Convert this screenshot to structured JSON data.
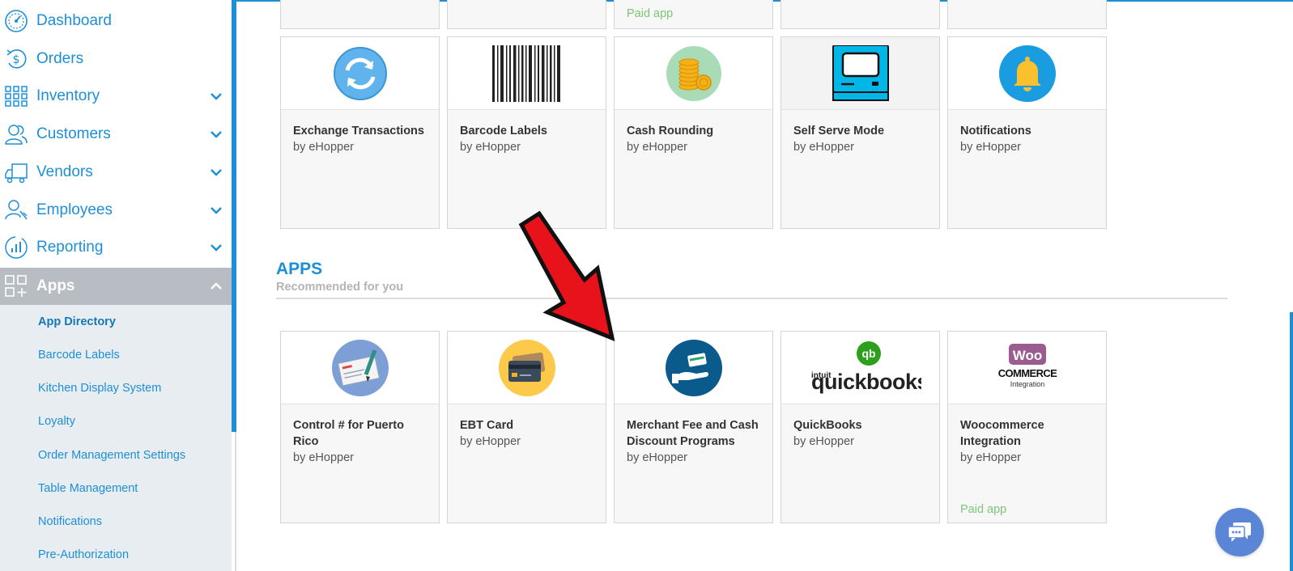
{
  "sidebar": {
    "items": [
      {
        "label": "Dashboard",
        "icon": "gauge-icon",
        "has_chevron": false
      },
      {
        "label": "Orders",
        "icon": "dollar-refresh-icon",
        "has_chevron": false
      },
      {
        "label": "Inventory",
        "icon": "grid-icon",
        "has_chevron": true
      },
      {
        "label": "Customers",
        "icon": "users-icon",
        "has_chevron": true
      },
      {
        "label": "Vendors",
        "icon": "truck-icon",
        "has_chevron": true
      },
      {
        "label": "Employees",
        "icon": "employee-icon",
        "has_chevron": true
      },
      {
        "label": "Reporting",
        "icon": "chart-circle-icon",
        "has_chevron": true
      },
      {
        "label": "Apps",
        "icon": "apps-icon",
        "has_chevron": true,
        "active": true
      }
    ],
    "subitems": [
      {
        "label": "App Directory",
        "current": true
      },
      {
        "label": "Barcode Labels"
      },
      {
        "label": "Kitchen Display System"
      },
      {
        "label": "Loyalty"
      },
      {
        "label": "Order Management Settings"
      },
      {
        "label": "Table Management"
      },
      {
        "label": "Notifications"
      },
      {
        "label": "Pre-Authorization"
      }
    ]
  },
  "top_partial": {
    "paid_label": "Paid app"
  },
  "top_row": [
    {
      "name": "Exchange Transactions",
      "by": "by eHopper",
      "icon": "exchange-refresh-icon"
    },
    {
      "name": "Barcode Labels",
      "by": "by eHopper",
      "icon": "barcode-icon"
    },
    {
      "name": "Cash Rounding",
      "by": "by eHopper",
      "icon": "coins-icon"
    },
    {
      "name": "Self Serve Mode",
      "by": "by eHopper",
      "icon": "kiosk-monitor-icon"
    },
    {
      "name": "Notifications",
      "by": "by eHopper",
      "icon": "bell-icon"
    }
  ],
  "apps_section": {
    "title": "APPS",
    "subtitle": "Recommended for you",
    "cards": [
      {
        "name": "Control # for Puerto Rico",
        "by": "by eHopper",
        "icon": "check-pen-icon"
      },
      {
        "name": "EBT Card",
        "by": "by eHopper",
        "icon": "cards-icon"
      },
      {
        "name": "Merchant Fee and Cash Discount Programs",
        "by": "by eHopper",
        "icon": "hand-card-icon"
      },
      {
        "name": "QuickBooks",
        "by": "by eHopper",
        "icon": "quickbooks-logo-icon",
        "logo_top": "intuit",
        "logo_main": "quickbooks",
        "logo_badge": "qb"
      },
      {
        "name": "Woocommerce Integration",
        "by": "by eHopper",
        "icon": "woocommerce-logo-icon",
        "paid_label": "Paid app",
        "logo_badge": "Woo",
        "logo_main": "COMMERCE",
        "logo_sub": "Integration"
      }
    ]
  },
  "colors": {
    "accent": "#1e8fd6",
    "paid": "#7cc576",
    "arrow": "#e8121b",
    "chat": "#5b86d8"
  }
}
